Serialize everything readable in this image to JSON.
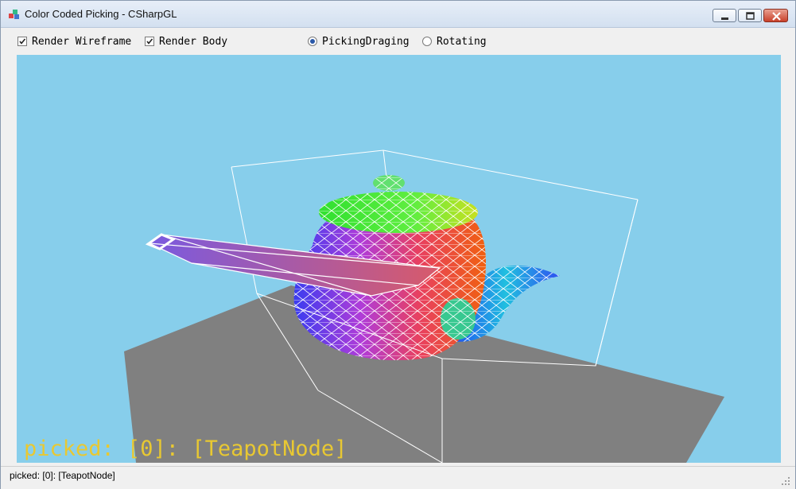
{
  "window": {
    "title": "Color Coded Picking - CSharpGL",
    "controls": {
      "minimize": "minimize-icon",
      "maximize": "maximize-icon",
      "close": "close-icon"
    }
  },
  "toolbar": {
    "render_wireframe": {
      "label": "Render Wireframe",
      "checked": true
    },
    "render_body": {
      "label": "Render Body",
      "checked": true
    },
    "mode_options": [
      {
        "label": "PickingDraging",
        "selected": true
      },
      {
        "label": "Rotating",
        "selected": false
      }
    ]
  },
  "viewport": {
    "background": "#87ceeb",
    "ground_color": "#808080",
    "wireframe_color": "#ffffff",
    "overlay_text": "picked: [0]: [TeapotNode]",
    "overlay_color": "#e8c832"
  },
  "status": {
    "text": "picked: [0]: [TeapotNode]"
  }
}
